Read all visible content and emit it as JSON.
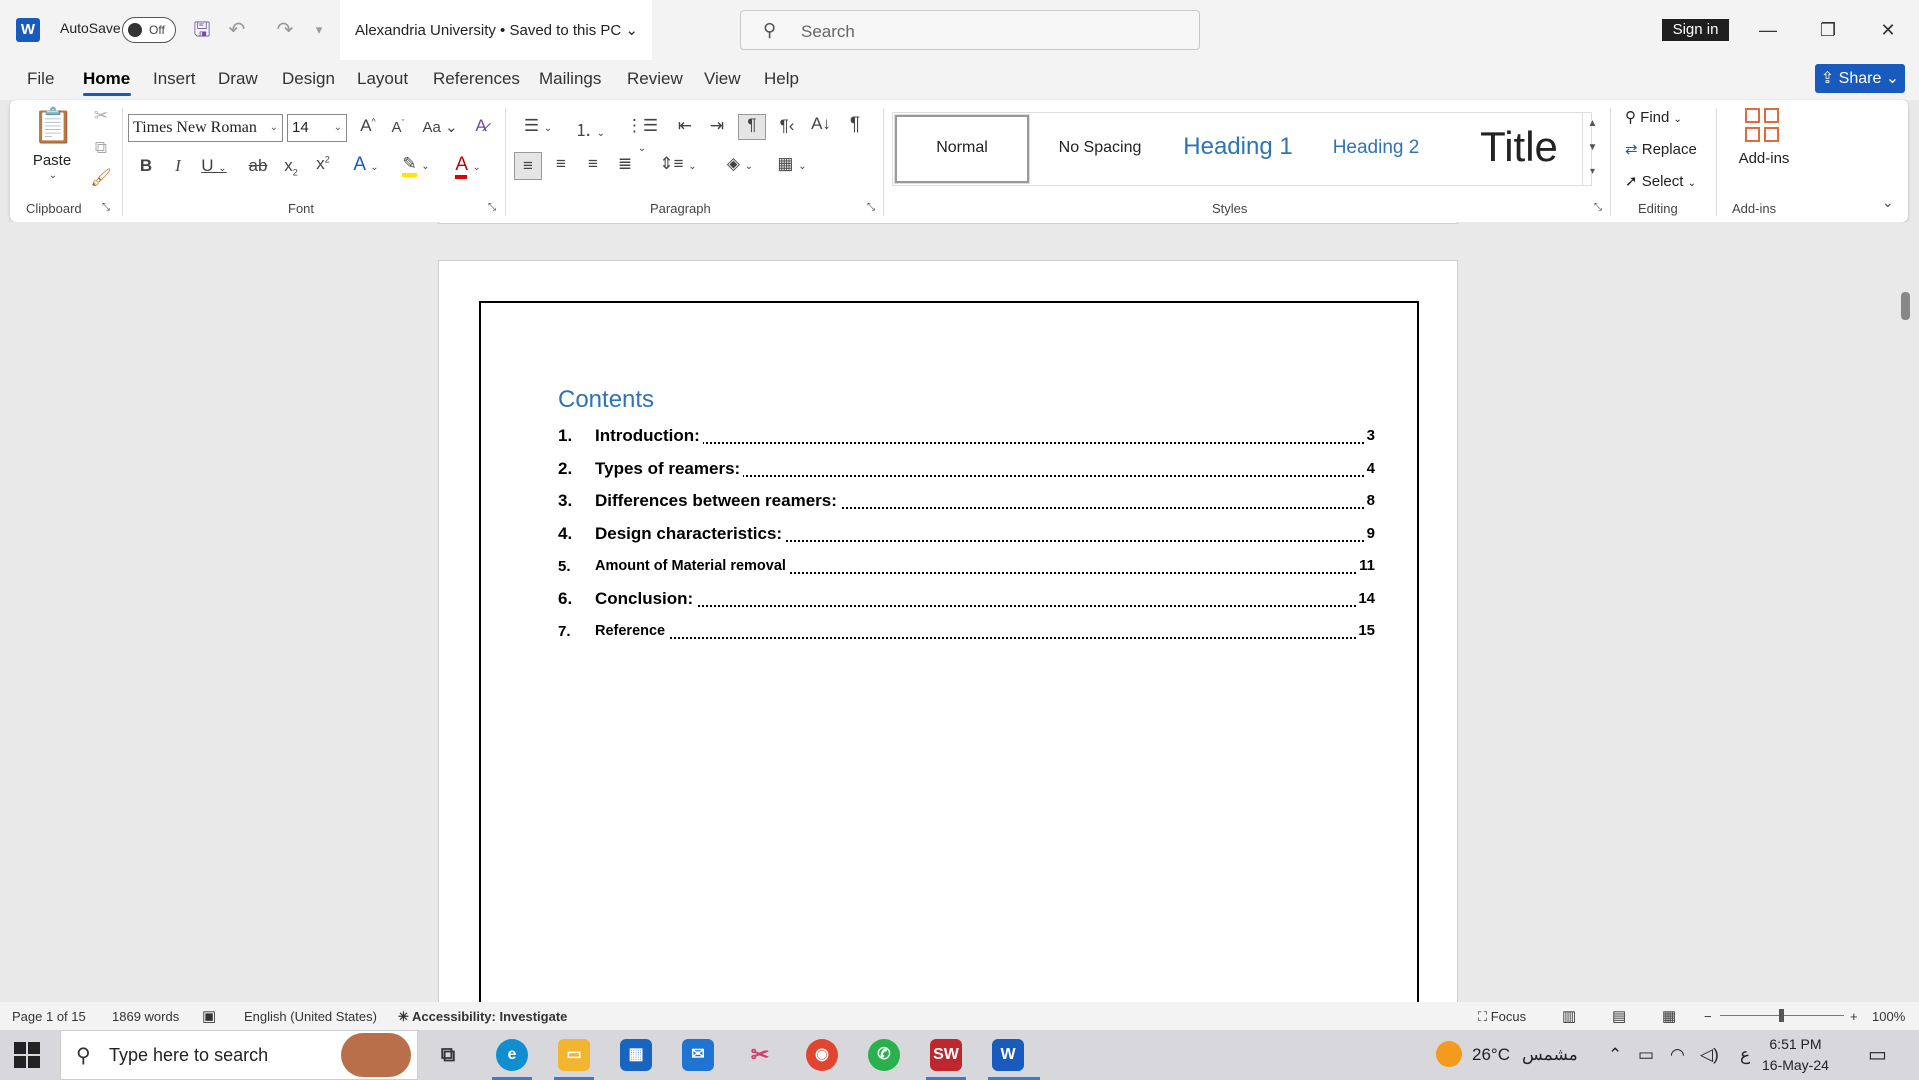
{
  "titlebar": {
    "autosave_label": "AutoSave",
    "autosave_state": "Off",
    "doc_title": "Alexandria University • Saved to this PC",
    "search_placeholder": "Search",
    "signin_label": "Sign in"
  },
  "menu": {
    "tabs": [
      "File",
      "Home",
      "Insert",
      "Draw",
      "Design",
      "Layout",
      "References",
      "Mailings",
      "Review",
      "View",
      "Help"
    ],
    "active": "Home",
    "share_label": "Share"
  },
  "ribbon": {
    "clipboard": {
      "paste_label": "Paste",
      "group_label": "Clipboard"
    },
    "font": {
      "name": "Times New Roman",
      "size": "14",
      "group_label": "Font"
    },
    "paragraph": {
      "group_label": "Paragraph"
    },
    "styles": {
      "items": [
        "Normal",
        "No Spacing",
        "Heading 1",
        "Heading 2",
        "Title"
      ],
      "group_label": "Styles"
    },
    "editing": {
      "find": "Find",
      "replace": "Replace",
      "select": "Select",
      "group_label": "Editing"
    },
    "addins": {
      "label": "Add-ins",
      "group_label": "Add-ins"
    }
  },
  "document": {
    "toc_heading": "Contents",
    "toc": [
      {
        "num": "1.",
        "text": "Introduction:",
        "page": "3"
      },
      {
        "num": "2.",
        "text": "Types of reamers:",
        "page": "4"
      },
      {
        "num": "3.",
        "text": "Differences between reamers:",
        "page": "8"
      },
      {
        "num": "4.",
        "text": "Design characteristics:",
        "page": "9"
      },
      {
        "num": "5.",
        "text": "Amount of Material removal",
        "page": "11"
      },
      {
        "num": "6.",
        "text": "Conclusion:",
        "page": "14"
      },
      {
        "num": "7.",
        "text": "Reference",
        "page": "15"
      }
    ]
  },
  "statusbar": {
    "page": "Page 1 of 15",
    "words": "1869 words",
    "language": "English (United States)",
    "accessibility": "Accessibility: Investigate",
    "focus": "Focus",
    "zoom": "100%"
  },
  "taskbar": {
    "search_placeholder": "Type here to search",
    "weather": "26°C",
    "weather_text": "مشمس",
    "input_lang": "ع",
    "time": "6:51 PM",
    "date": "16-May-24"
  },
  "colors": {
    "word_blue": "#185abd",
    "heading_blue": "#2e74b5",
    "addins_orange": "#e06b3c"
  }
}
